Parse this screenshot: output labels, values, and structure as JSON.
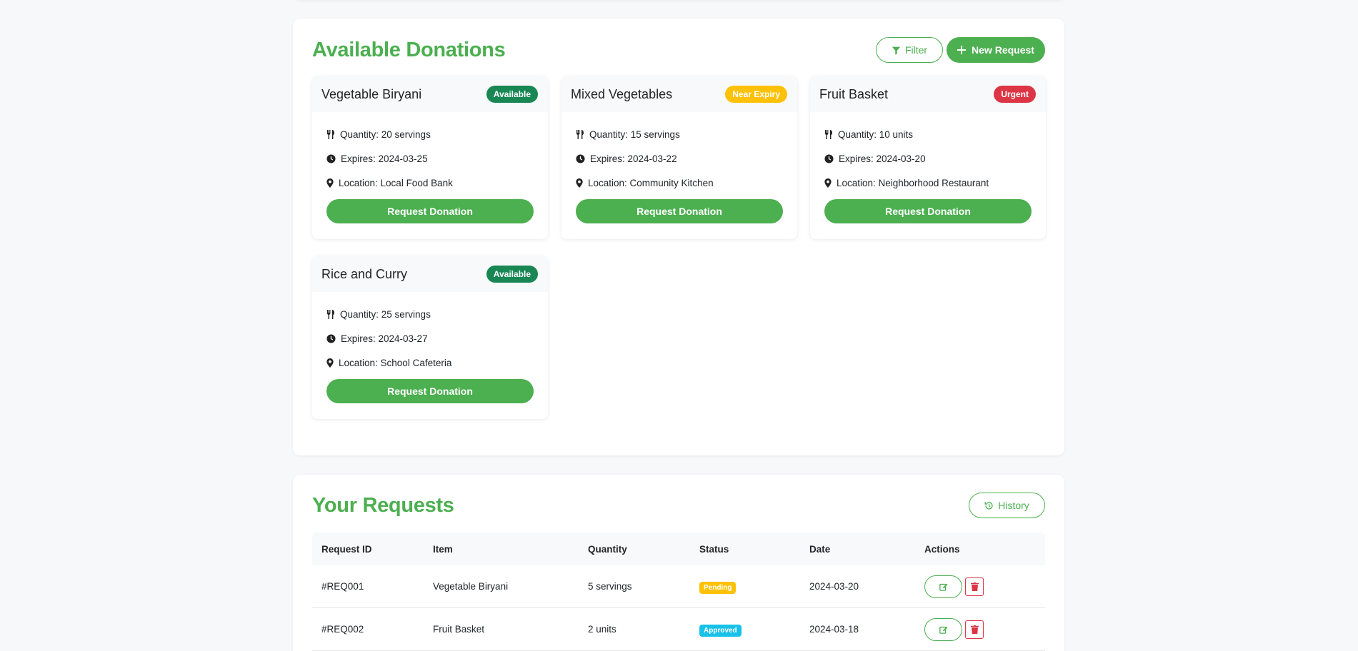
{
  "colors": {
    "accent": "#4caf50",
    "available": "#198754",
    "near_expiry": "#ffc107",
    "urgent": "#dc3545",
    "pending": "#ffc107",
    "approved": "#17c1e8"
  },
  "donations": {
    "title": "Available Donations",
    "filter_label": "Filter",
    "new_request_label": "New Request",
    "cards": [
      {
        "name": "Vegetable Biryani",
        "badge": "Available",
        "quantity": "Quantity: 20 servings",
        "expires": "Expires: 2024-03-25",
        "location": "Location: Local Food Bank",
        "button": "Request Donation"
      },
      {
        "name": "Mixed Vegetables",
        "badge": "Near Expiry",
        "quantity": "Quantity: 15 servings",
        "expires": "Expires: 2024-03-22",
        "location": "Location: Community Kitchen",
        "button": "Request Donation"
      },
      {
        "name": "Fruit Basket",
        "badge": "Urgent",
        "quantity": "Quantity: 10 units",
        "expires": "Expires: 2024-03-20",
        "location": "Location: Neighborhood Restaurant",
        "button": "Request Donation"
      },
      {
        "name": "Rice and Curry",
        "badge": "Available",
        "quantity": "Quantity: 25 servings",
        "expires": "Expires: 2024-03-27",
        "location": "Location: School Cafeteria",
        "button": "Request Donation"
      }
    ]
  },
  "requests": {
    "title": "Your Requests",
    "history_label": "History",
    "columns": [
      "Request ID",
      "Item",
      "Quantity",
      "Status",
      "Date",
      "Actions"
    ],
    "rows": [
      {
        "id": "#REQ001",
        "item": "Vegetable Biryani",
        "quantity": "5 servings",
        "status": "Pending",
        "date": "2024-03-20"
      },
      {
        "id": "#REQ002",
        "item": "Fruit Basket",
        "quantity": "2 units",
        "status": "Approved",
        "date": "2024-03-18"
      }
    ]
  }
}
